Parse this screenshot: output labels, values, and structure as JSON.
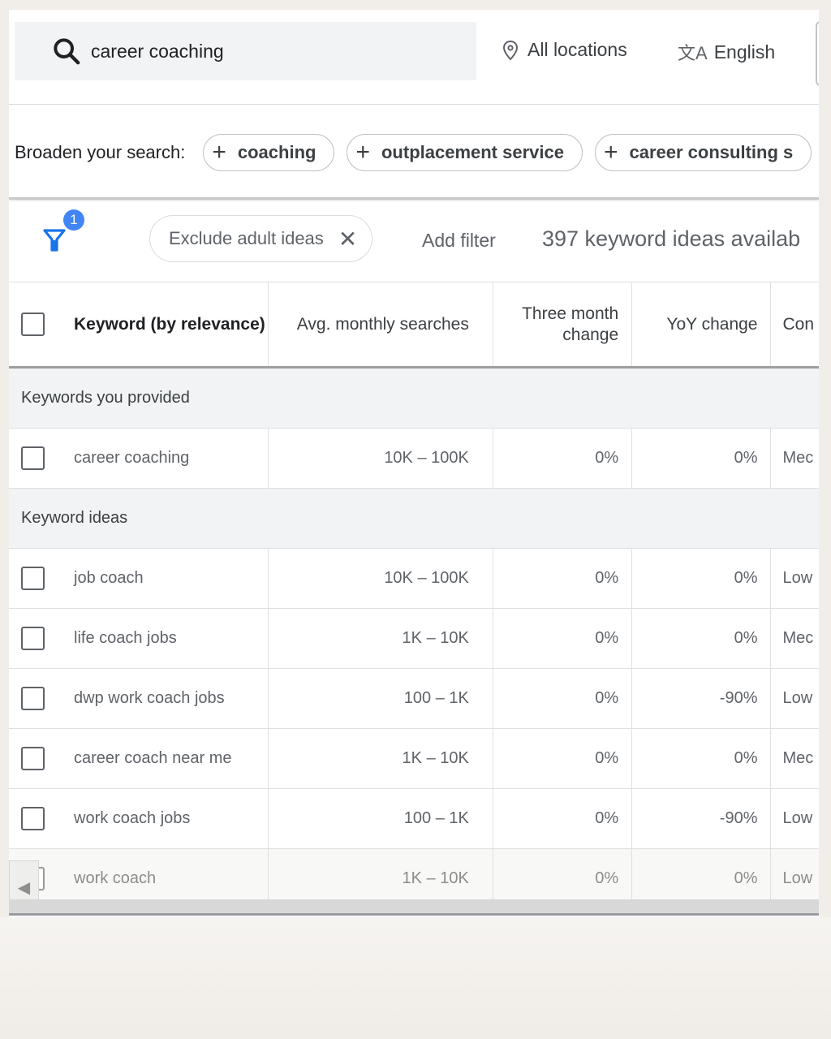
{
  "search": {
    "query": "career coaching",
    "icon": "search-icon",
    "location_label": "All locations",
    "location_icon": "location-pin-icon",
    "language_label": "English",
    "language_icon": "translate-icon",
    "language_icon_glyph": "文A"
  },
  "broaden": {
    "label": "Broaden your search:",
    "chips": [
      {
        "plus": "+",
        "label": "coaching"
      },
      {
        "plus": "+",
        "label": "outplacement service"
      },
      {
        "plus": "+",
        "label": "career consulting s"
      }
    ]
  },
  "filters": {
    "filter_icon": "filter-funnel-icon",
    "badge_count": "1",
    "active_filter_label": "Exclude adult ideas",
    "remove_glyph": "✕",
    "add_filter_label": "Add filter",
    "keyword_count_text": "397 keyword ideas availab"
  },
  "table": {
    "columns": [
      {
        "key": "keyword",
        "label": "Keyword (by relevance)"
      },
      {
        "key": "avg_monthly_searches",
        "label": "Avg. monthly searches"
      },
      {
        "key": "three_month_change",
        "label": "Three month change",
        "label_line1": "Three month",
        "label_line2": "change"
      },
      {
        "key": "yoy_change",
        "label": "YoY change"
      },
      {
        "key": "competition",
        "label": "Con"
      }
    ],
    "groups": [
      {
        "title": "Keywords you provided",
        "rows": [
          {
            "keyword": "career coaching",
            "avg": "10K – 100K",
            "three": "0%",
            "yoy": "0%",
            "comp": "Mec"
          }
        ]
      },
      {
        "title": "Keyword ideas",
        "rows": [
          {
            "keyword": "job coach",
            "avg": "10K – 100K",
            "three": "0%",
            "yoy": "0%",
            "comp": "Low"
          },
          {
            "keyword": "life coach jobs",
            "avg": "1K – 10K",
            "three": "0%",
            "yoy": "0%",
            "comp": "Mec"
          },
          {
            "keyword": "dwp work coach jobs",
            "avg": "100 – 1K",
            "three": "0%",
            "yoy": "-90%",
            "comp": "Low"
          },
          {
            "keyword": "career coach near me",
            "avg": "1K – 10K",
            "three": "0%",
            "yoy": "0%",
            "comp": "Mec"
          },
          {
            "keyword": "work coach jobs",
            "avg": "100 – 1K",
            "three": "0%",
            "yoy": "-90%",
            "comp": "Low"
          },
          {
            "keyword": "work coach",
            "avg": "1K – 10K",
            "three": "0%",
            "yoy": "0%",
            "comp": "Low"
          }
        ]
      }
    ]
  },
  "scroll": {
    "left_arrow_glyph": "◀"
  },
  "colors": {
    "accent": "#4285f4",
    "group_bg": "#f1f3f4",
    "search_bg": "#f1f3f4"
  }
}
